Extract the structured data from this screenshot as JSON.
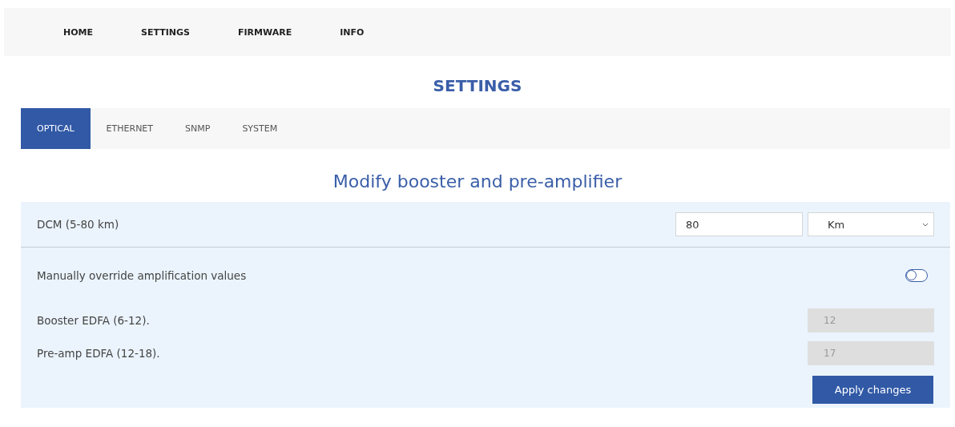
{
  "nav": [
    {
      "label": "HOME"
    },
    {
      "label": "SETTINGS"
    },
    {
      "label": "FIRMWARE"
    },
    {
      "label": "INFO"
    }
  ],
  "page_title": "SETTINGS",
  "tabs": [
    {
      "label": "OPTICAL",
      "selected": true
    },
    {
      "label": "ETHERNET",
      "selected": false
    },
    {
      "label": "SNMP",
      "selected": false
    },
    {
      "label": "SYSTEM",
      "selected": false
    }
  ],
  "heading": "Modify booster and pre-amplifier",
  "dcm": {
    "label": "DCM (5-80 km)",
    "value": "80",
    "unit": "Km"
  },
  "override": {
    "label": "Manually override amplification values",
    "on": false
  },
  "fields": [
    {
      "label": "Booster EDFA (6-12).",
      "value": "12",
      "disabled": true
    },
    {
      "label": "Pre-amp EDFA (12-18).",
      "value": "17",
      "disabled": true
    }
  ],
  "apply_button": "Apply changes"
}
